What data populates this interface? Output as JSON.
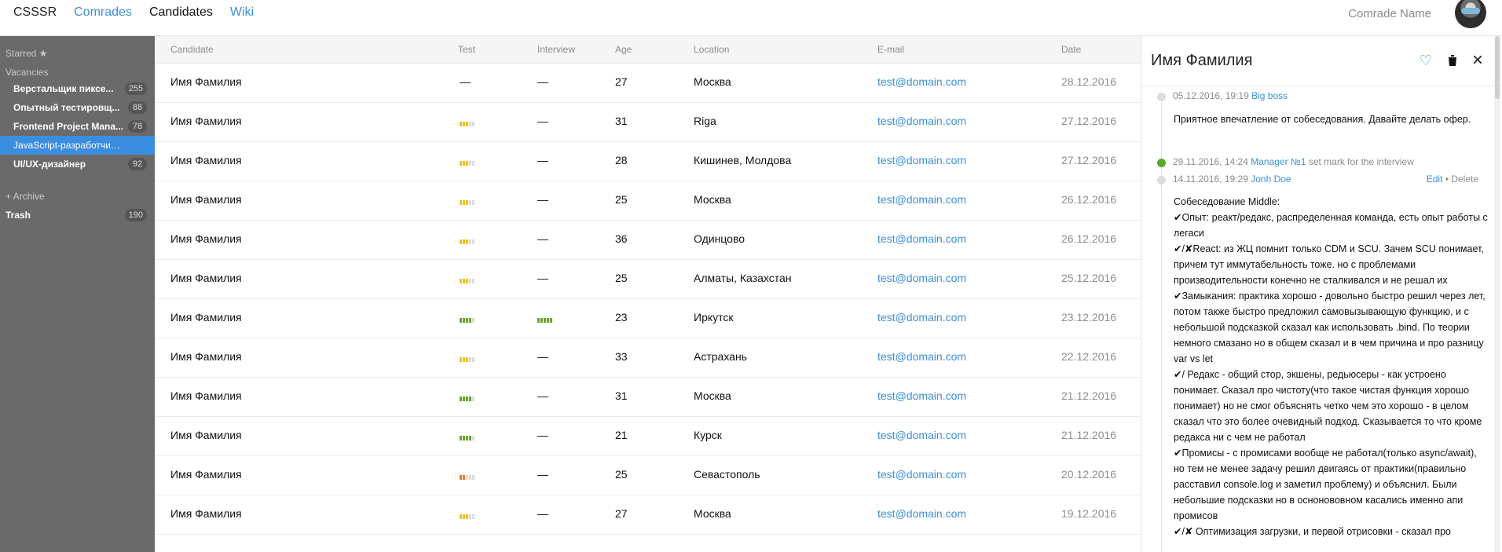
{
  "nav": {
    "brand": "CSSSR",
    "links": [
      "Comrades",
      "Candidates",
      "Wiki"
    ],
    "comrade_name": "Comrade Name"
  },
  "sidebar": {
    "starred": "Starred ★",
    "vacancies_label": "Vacancies",
    "vacancies": [
      {
        "label": "Верстальщик пиксе...",
        "count": "255"
      },
      {
        "label": "Опытный тестировщ...",
        "count": "88"
      },
      {
        "label": "Frontend Project Mana...",
        "count": "78"
      },
      {
        "label": "JavaScript-разработчик (Ang...",
        "count": ""
      },
      {
        "label": "UI/UX-дизайнер",
        "count": "92"
      }
    ],
    "archive": "+ Archive",
    "trash": {
      "label": "Trash",
      "count": "190"
    }
  },
  "table": {
    "columns": [
      "Candidate",
      "Test",
      "Interview",
      "Age",
      "Location",
      "E-mail",
      "Date"
    ],
    "rows": [
      {
        "name": "Имя Фамилия",
        "test": "—",
        "interview": "—",
        "age": "27",
        "location": "Москва",
        "email": "test@domain.com",
        "date": "28.12.2016"
      },
      {
        "name": "Имя Фамилия",
        "test_level": 3,
        "interview": "—",
        "age": "31",
        "location": "Riga",
        "email": "test@domain.com",
        "date": "27.12.2016"
      },
      {
        "name": "Имя Фамилия",
        "test_level": 3,
        "interview": "—",
        "age": "28",
        "location": "Кишинев, Молдова",
        "email": "test@domain.com",
        "date": "27.12.2016"
      },
      {
        "name": "Имя Фамилия",
        "test_level": 3,
        "interview": "—",
        "age": "25",
        "location": "Москва",
        "email": "test@domain.com",
        "date": "26.12.2016"
      },
      {
        "name": "Имя Фамилия",
        "test_level": 3,
        "interview": "—",
        "age": "36",
        "location": "Одинцово",
        "email": "test@domain.com",
        "date": "26.12.2016"
      },
      {
        "name": "Имя Фамилия",
        "test_level": 3,
        "interview": "—",
        "age": "25",
        "location": "Алматы, Казахстан",
        "email": "test@domain.com",
        "date": "25.12.2016"
      },
      {
        "name": "Имя Фамилия",
        "test_level": 4,
        "interview_level": 5,
        "age": "23",
        "location": "Иркутск",
        "email": "test@domain.com",
        "date": "23.12.2016"
      },
      {
        "name": "Имя Фамилия",
        "test_level": 3,
        "interview": "—",
        "age": "33",
        "location": "Астрахань",
        "email": "test@domain.com",
        "date": "22.12.2016"
      },
      {
        "name": "Имя Фамилия",
        "test_level": 4,
        "interview": "—",
        "age": "31",
        "location": "Москва",
        "email": "test@domain.com",
        "date": "21.12.2016"
      },
      {
        "name": "Имя Фамилия",
        "test_level": 4,
        "interview": "—",
        "age": "21",
        "location": "Курск",
        "email": "test@domain.com",
        "date": "21.12.2016"
      },
      {
        "name": "Имя Фамилия",
        "test_level": 2,
        "interview": "—",
        "age": "25",
        "location": "Севастополь",
        "email": "test@domain.com",
        "date": "20.12.2016"
      },
      {
        "name": "Имя Фамилия",
        "test_level": 3,
        "interview": "—",
        "age": "27",
        "location": "Москва",
        "email": "test@domain.com",
        "date": "19.12.2016"
      }
    ]
  },
  "panel": {
    "title": "Имя Фамилия",
    "timeline": [
      {
        "datetime": "05.12.2016, 19:19",
        "author": "Big boss",
        "text": "Приятное впечатление от собеседования. Давайте делать офер."
      },
      {
        "datetime": "29.11.2016, 14:24",
        "author": "Manager №1",
        "action": "set mark for the interview"
      },
      {
        "datetime": "14.11.2016, 19:29",
        "author": "Jonh Doe",
        "edit": "Edit",
        "sep": "•",
        "delete": "Delete",
        "text_lines": [
          "Собеседование Middle:",
          "✔Опыт: реакт/редакс, распределенная команда, есть опыт работы с легаси",
          "✔/✘React: из ЖЦ помнит только CDM и SCU. Зачем SCU понимает, причем тут иммутабельность тоже. но с проблемами производительности конечно не сталкивался и не решал их",
          "✔Замыкания: практика хорошо - довольно быстро решил через лет, потом также быстро предложил самовызывающую функцию, и с небольшой подсказкой сказал как использовать .bind. По теории немного смазано но в общем сказал и в чем причина и про разницу var vs let",
          "✔/ Редакс - общий стор, экшены, редьюсеры - как устроено понимает. Сказал про чистоту(что такое чистая функция хорошо понимает) но не смог объяснять четко чем это хорошо - в целом сказал что это более очевидный подход. Сказывается то что кроме редакса ни с чем не работал",
          "✔Промисы - с промисами вообще не работал(только async/await), но тем не менее задачу решил двигаясь от практики(правильно расставил console.log и заметил проблему) и объяснил. Были небольшие подсказки но в оснонововном касались именно апи промисов",
          "✔/✘ Оптимизация загрузки, и первой отрисовки - сказал про"
        ]
      }
    ]
  },
  "colors": {
    "accent": "#3d8fd8",
    "sidebar": "#6a6a6a",
    "selected": "#3b8de0",
    "bar_yellow": "#f0c419",
    "bar_green": "#6aa52b",
    "bar_orange": "#e97a24"
  }
}
